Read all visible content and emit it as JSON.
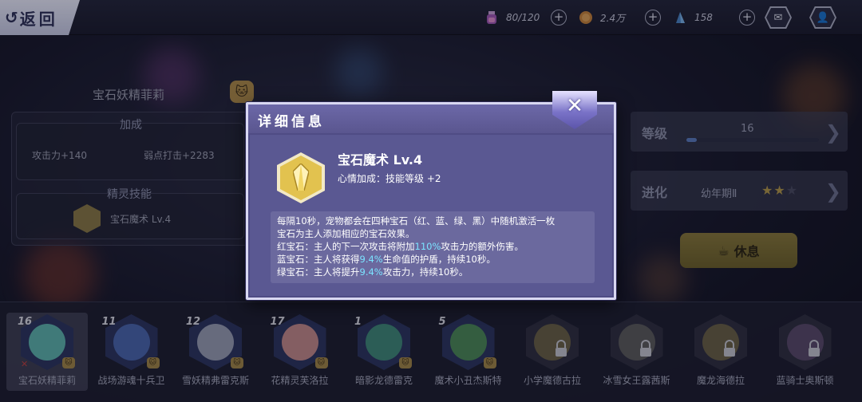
{
  "topbar": {
    "back_label": "返回",
    "resources": [
      {
        "icon": "stamina-potion-icon",
        "value": "80/120"
      },
      {
        "icon": "gold-coin-icon",
        "value": "2.4万"
      },
      {
        "icon": "blue-crystal-icon",
        "value": "158"
      }
    ],
    "plus_label": "+",
    "mail_icon": "envelope-icon",
    "friends_icon": "friends-icon"
  },
  "pet_info": {
    "name": "宝石妖精菲莉",
    "bonus_title": "加成",
    "stats": [
      {
        "label": "攻击力+140"
      },
      {
        "label": "弱点打击+2283"
      }
    ],
    "skill_title": "精灵技能",
    "skill_label": "宝石魔术 Lv.4"
  },
  "right_panel": {
    "level_label": "等级",
    "level_value": "16",
    "level_progress": 0.08,
    "evolve_label": "进化",
    "evolve_value": "幼年期Ⅱ",
    "stars_filled": 2,
    "stars_total": 3,
    "rest_label": "休息"
  },
  "modal": {
    "title": "详细信息",
    "close_label": "✕",
    "skill_name": "宝石魔术 Lv.4",
    "skill_sub": "心情加成：技能等级 +2",
    "desc": {
      "line1": "每隔10秒，宠物都会在四种宝石（红、蓝、绿、黑）中随机激活一枚",
      "line2": "宝石为主人添加相应的宝石效果。",
      "line3a": "红宝石：主人的下一次攻击将附加",
      "line3b": "110%",
      "line3c": "攻击力的额外伤害。",
      "line4a": "蓝宝石：主人将获得",
      "line4b": "9.4%",
      "line4c": "生命值的护盾，持续10秒。",
      "line5a": "绿宝石：主人将提升",
      "line5b": "9.4%",
      "line5c": "攻击力，持续10秒。"
    }
  },
  "pets": [
    {
      "level": "16",
      "name": "宝石妖精菲莉",
      "color": "#5fb7b0",
      "locked": false,
      "selected": true
    },
    {
      "level": "11",
      "name": "战场游魂十兵卫",
      "color": "#4a67b0",
      "locked": false,
      "selected": false
    },
    {
      "level": "12",
      "name": "雪妖精弗雷克斯",
      "color": "#9aa0b6",
      "locked": false,
      "selected": false
    },
    {
      "level": "17",
      "name": "花精灵芙洛拉",
      "color": "#c68c8c",
      "locked": false,
      "selected": false
    },
    {
      "level": "1",
      "name": "暗影龙德雷克",
      "color": "#3f8a7a",
      "locked": false,
      "selected": false
    },
    {
      "level": "5",
      "name": "魔术小丑杰斯特",
      "color": "#4c8a58",
      "locked": false,
      "selected": false
    },
    {
      "level": "",
      "name": "小学魔德古拉",
      "color": "#6a6246",
      "locked": true,
      "selected": false
    },
    {
      "level": "",
      "name": "冰雪女王露茜斯",
      "color": "#5c5c5c",
      "locked": true,
      "selected": false
    },
    {
      "level": "",
      "name": "魔龙海德拉",
      "color": "#6a6246",
      "locked": true,
      "selected": false
    },
    {
      "level": "",
      "name": "蓝骑士奥斯顿",
      "color": "#5a4a6a",
      "locked": true,
      "selected": false
    }
  ]
}
